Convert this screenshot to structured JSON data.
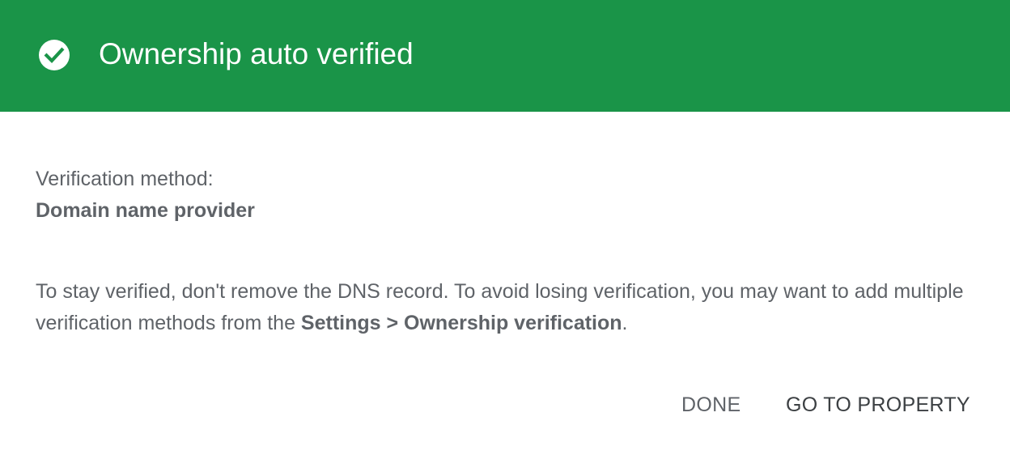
{
  "header": {
    "icon": "check-circle-icon",
    "title": "Ownership auto verified",
    "background_color": "#1a9448"
  },
  "verification": {
    "label": "Verification method:",
    "value": "Domain name provider"
  },
  "info": {
    "text_before": "To stay verified, don't remove the DNS record. To avoid losing verification, you may want to add multiple verification methods from the ",
    "bold_path": "Settings > Ownership verification",
    "text_after": "."
  },
  "actions": {
    "done_label": "DONE",
    "go_to_property_label": "GO TO PROPERTY"
  }
}
